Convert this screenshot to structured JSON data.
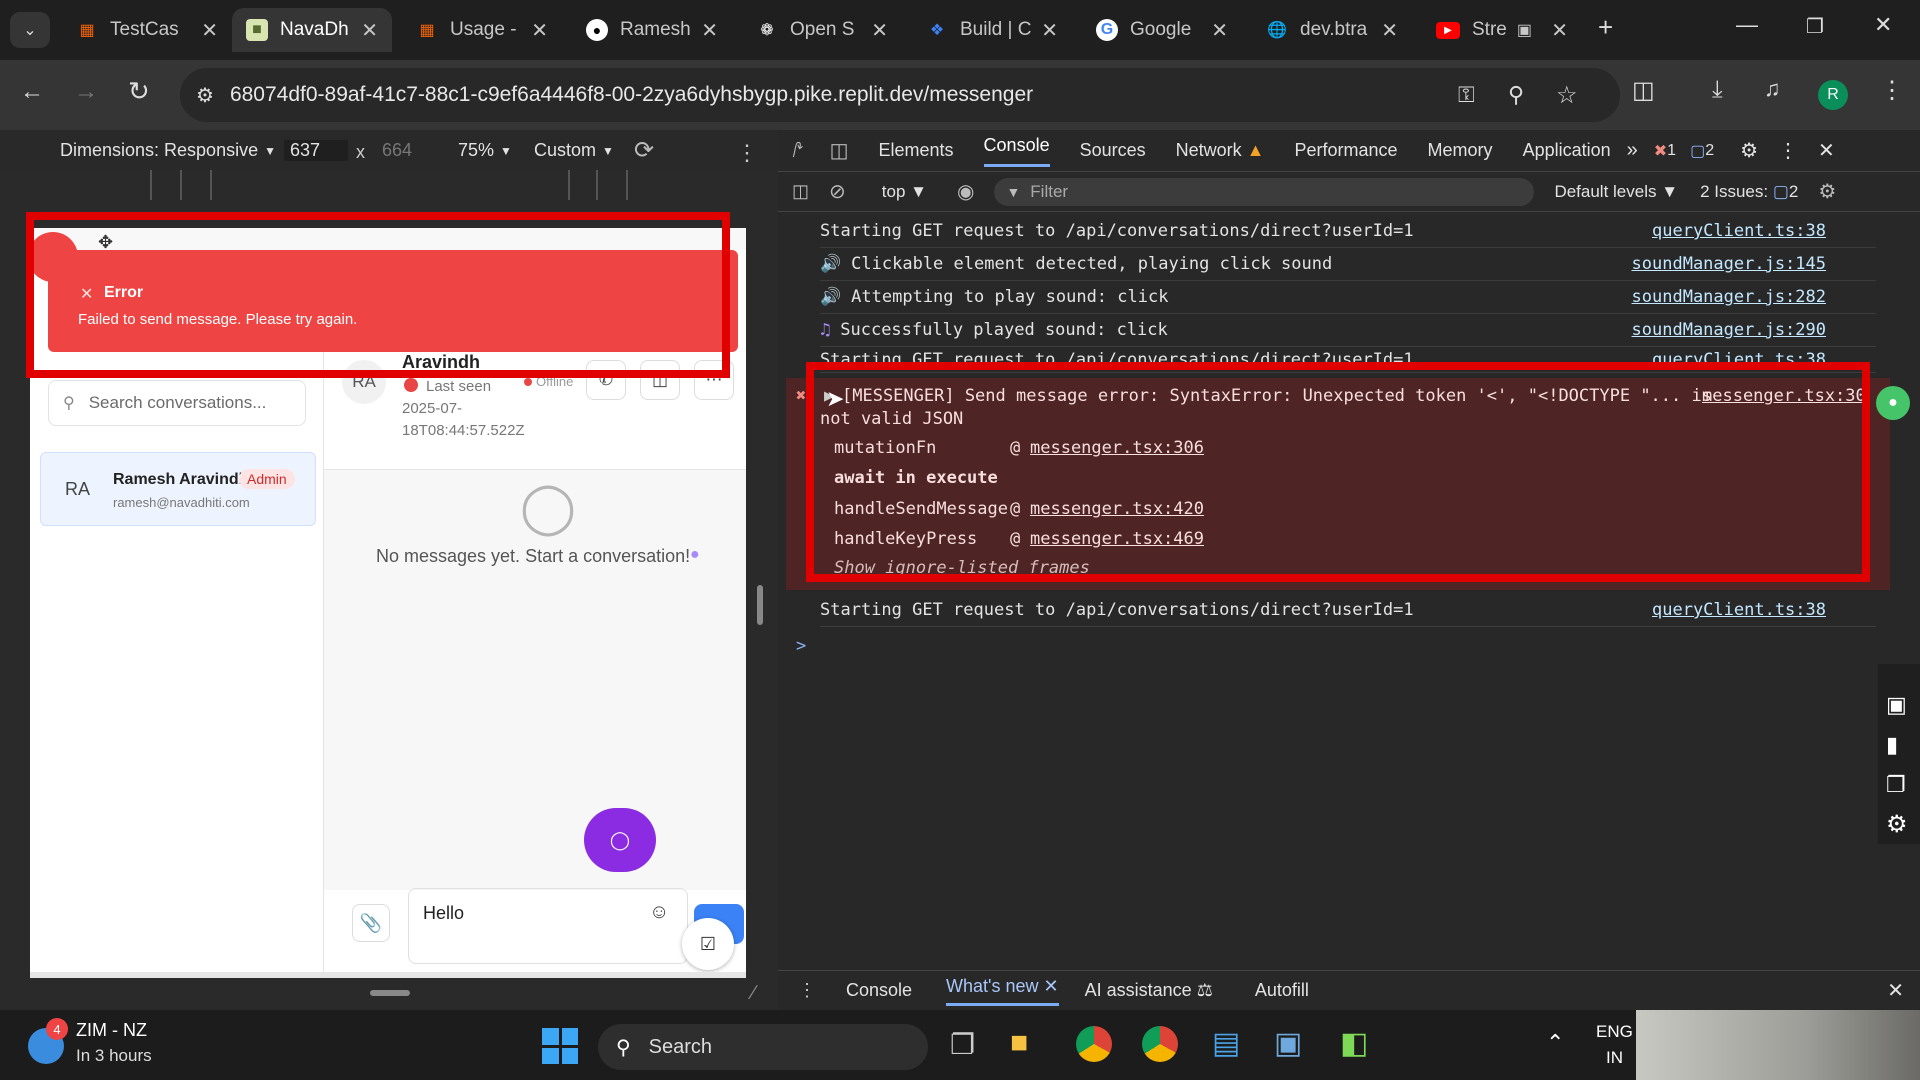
{
  "browser": {
    "tabs": [
      {
        "title": "TestCas",
        "icon": "replit-icon"
      },
      {
        "title": "NavaDh",
        "icon": "navadh-icon",
        "active": true
      },
      {
        "title": "Usage -",
        "icon": "replit-icon"
      },
      {
        "title": "Ramesh",
        "icon": "github-icon"
      },
      {
        "title": "Open S",
        "icon": "openai-icon"
      },
      {
        "title": "Build | C",
        "icon": "butterfly-icon"
      },
      {
        "title": "Google",
        "icon": "google-icon"
      },
      {
        "title": "dev.btra",
        "icon": "globe-icon"
      },
      {
        "title": "Stre",
        "icon": "youtube-icon"
      }
    ],
    "url": "68074df0-89af-41c7-88c1-c9ef6a4446f8-00-2zya6dyhsbygp.pike.replit.dev/messenger",
    "profile_initial": "R"
  },
  "device_toolbar": {
    "dimensions_label": "Dimensions: Responsive",
    "width": "637",
    "times": "x",
    "height": "664",
    "zoom": "75%",
    "throttle": "Custom"
  },
  "app": {
    "toast": {
      "title": "Error",
      "message": "Failed to send message. Please try again."
    },
    "search_placeholder": "Search conversations...",
    "user": {
      "initials": "RA",
      "name": "Ramesh Aravindh",
      "badge": "Admin",
      "email": "ramesh@navadhiti.com"
    },
    "chat": {
      "initials": "RA",
      "name": "Aravindh",
      "last_seen": "Last seen",
      "last_seen_date_1": "2025-07-",
      "last_seen_date_2": "18T08:44:57.522Z",
      "status": "Offline",
      "empty_text": "No messages yet. Start a conversation!",
      "input_value": "Hello"
    }
  },
  "devtools": {
    "tabs": [
      "Elements",
      "Console",
      "Sources",
      "Network",
      "Performance",
      "Memory",
      "Application"
    ],
    "error_count": "1",
    "message_count": "2",
    "context": "top",
    "filter_placeholder": "Filter",
    "levels": "Default levels",
    "issues_label": "2 Issues:",
    "issues_count": "2",
    "logs": [
      {
        "text": "Starting GET request to /api/conversations/direct?userId=1",
        "source": "queryClient.ts:38"
      },
      {
        "text": "Clickable element detected, playing click sound",
        "source": "soundManager.js:145"
      },
      {
        "text": "Attempting to play sound: click",
        "source": "soundManager.js:282"
      },
      {
        "text": "Successfully played sound: click",
        "source": "soundManager.js:290"
      },
      {
        "text": "Starting GET request to /api/conversations/direct?userId=1",
        "source": "queryClient.ts:38"
      }
    ],
    "error": {
      "line1": "[MESSENGER] Send message error: SyntaxError: Unexpected token '<', \"<!DOCTYPE \"... is",
      "line2": "not valid JSON",
      "source": "messenger.tsx:30",
      "stack": [
        {
          "fn": "mutationFn",
          "at": "@",
          "loc": "messenger.tsx:306"
        },
        {
          "fn": "await in execute"
        },
        {
          "fn": "handleSendMessage",
          "at": "@",
          "loc": "messenger.tsx:420"
        },
        {
          "fn": "handleKeyPress",
          "at": "@",
          "loc": "messenger.tsx:469"
        }
      ],
      "ignore_link": "Show ignore-listed frames"
    },
    "last_log": {
      "text": "Starting GET request to /api/conversations/direct?userId=1",
      "source": "queryClient.ts:38"
    },
    "prompt": ">",
    "drawer_tabs": [
      "Console",
      "What's new",
      "AI assistance",
      "Autofill"
    ]
  },
  "taskbar": {
    "weather_badge": "4",
    "weather_title": "ZIM - NZ",
    "weather_sub": "In 3 hours",
    "search_label": "Search",
    "lang_1": "ENG",
    "lang_2": "IN"
  }
}
